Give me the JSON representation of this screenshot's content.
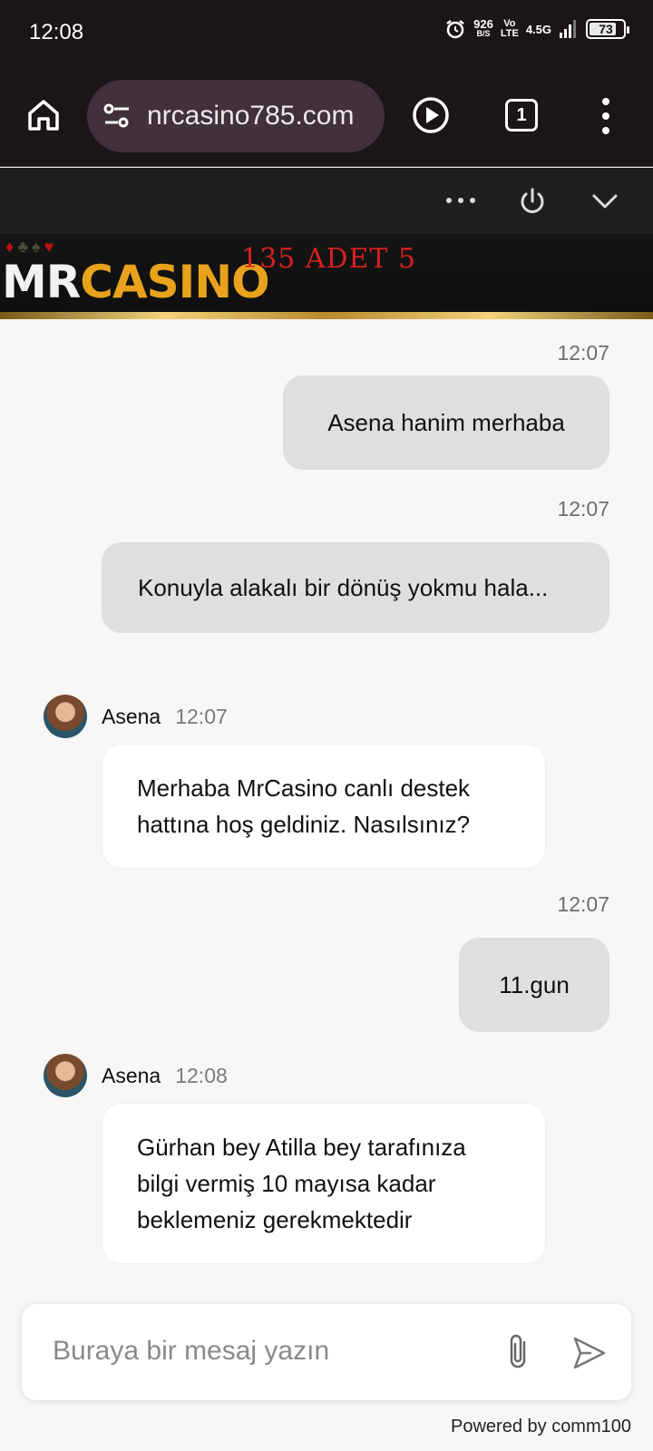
{
  "status_bar": {
    "time": "12:08",
    "net_speed": "926",
    "net_unit": "B/S",
    "volte_top": "Vo",
    "volte_bottom": "LTE",
    "network": "4.5G",
    "battery": "73"
  },
  "browser": {
    "url": "nrcasino785.com",
    "tab_count": "1"
  },
  "banner": {
    "logo_mr": "MR",
    "logo_casino": "CASINO",
    "promo_text": "135 ADET 5"
  },
  "messages": [
    {
      "from": "user",
      "time": "12:07",
      "text": "Asena hanim merhaba"
    },
    {
      "from": "user",
      "time": "12:07",
      "text": "Konuyla alakalı bir dönüş yokmu hala..."
    },
    {
      "from": "agent",
      "name": "Asena",
      "time": "12:07",
      "text": "Merhaba MrCasino canlı destek hattına hoş geldiniz. Nasılsınız?"
    },
    {
      "from": "user",
      "time": "12:07",
      "text": "11.gun"
    },
    {
      "from": "agent",
      "name": "Asena",
      "time": "12:08",
      "text": "Gürhan bey Atilla bey tarafınıza bilgi vermiş 10 mayısa kadar beklemeniz gerekmektedir"
    }
  ],
  "composer": {
    "placeholder": "Buraya bir mesaj yazın",
    "value": ""
  },
  "footer": {
    "powered_by": "Powered by comm100"
  },
  "icons": {
    "home": "home-icon",
    "site_settings": "tune-icon",
    "play": "play-icon",
    "menu": "more-vert-icon",
    "chat_more": "more-horiz-icon",
    "power": "power-icon",
    "minimize": "chevron-down-icon",
    "attach": "paperclip-icon",
    "send": "send-icon"
  },
  "colors": {
    "browser_bg": "#1b1418",
    "user_bubble": "#dfdfdf",
    "agent_bubble": "#ffffff",
    "chat_bg": "#f8f7f5",
    "logo_gold": "#e8a21c",
    "promo_red": "#d62020"
  }
}
